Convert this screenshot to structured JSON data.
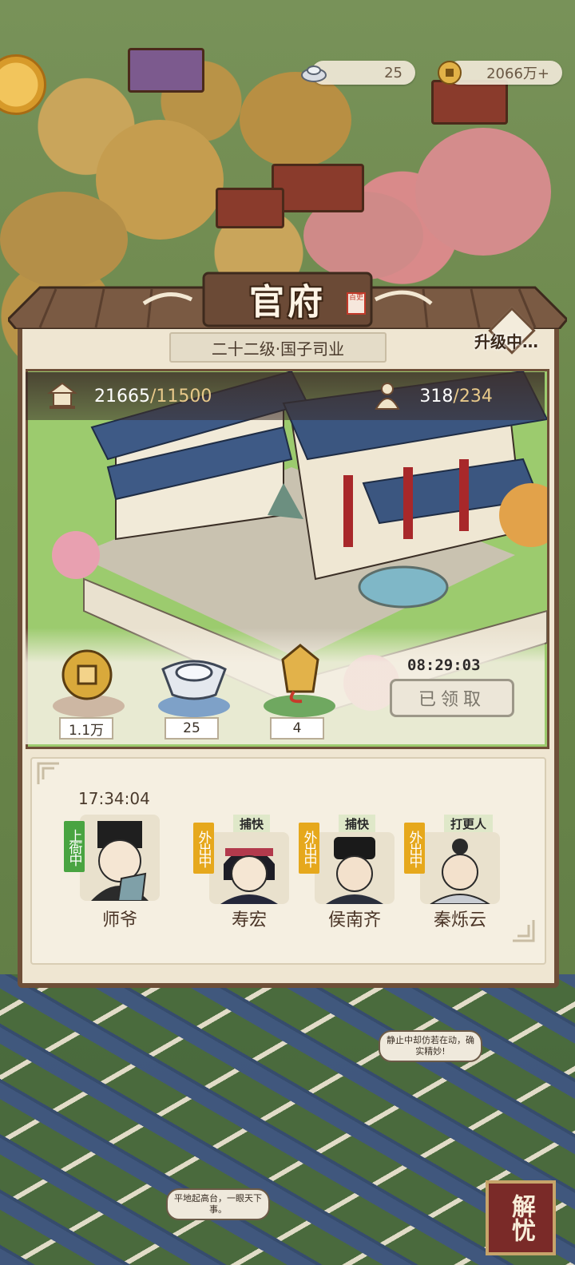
{
  "hud": {
    "silver": "25",
    "gold": "2066万+"
  },
  "panel": {
    "title": "官府",
    "seal_text": "百吏",
    "rank": "二十二级·国子司业",
    "upgrade_status": "升级中…",
    "stats": {
      "prosperity_current": "21665",
      "prosperity_max": "/11500",
      "people_current": "318",
      "people_max": "/234"
    },
    "rewards": [
      {
        "icon": "copper-coin-icon",
        "value": "1.1万"
      },
      {
        "icon": "silver-ingot-icon",
        "value": "25"
      },
      {
        "icon": "token-plaque-icon",
        "value": "4"
      }
    ],
    "reward_timer": "08:29:03",
    "claimed_button": "已领取"
  },
  "staff": {
    "timer": "17:34:04",
    "members": [
      {
        "name": "师爷",
        "role": "",
        "status": "上衙中",
        "status_color": "#49a441"
      },
      {
        "name": "寿宏",
        "role": "捕快",
        "status": "外出中",
        "status_color": "#e6a81c"
      },
      {
        "name": "侯南齐",
        "role": "捕快",
        "status": "外出中",
        "status_color": "#e6a81c"
      },
      {
        "name": "秦烁云",
        "role": "打更人",
        "status": "外出中",
        "status_color": "#e6a81c"
      }
    ]
  },
  "bubbles": {
    "right": "静止中却仿若在动，确实精妙!",
    "left": "平地起高台，一眼天下事。"
  },
  "jieyou_button": "解忧"
}
